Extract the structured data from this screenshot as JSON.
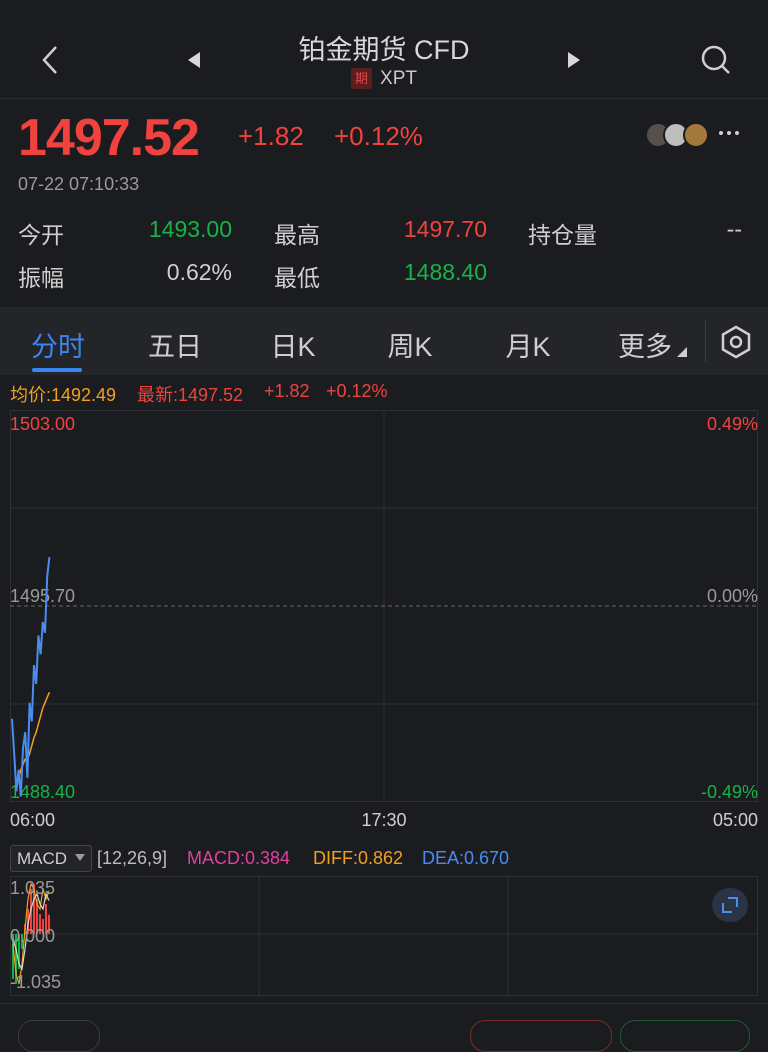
{
  "header": {
    "title": "铂金期货 CFD",
    "badge": "期",
    "symbol": "XPT"
  },
  "quote": {
    "price": "1497.52",
    "change": "+1.82",
    "change_pct": "+0.12%",
    "timestamp": "07-22 07:10:33"
  },
  "stats": {
    "open_label": "今开",
    "open": "1493.00",
    "high_label": "最高",
    "high": "1497.70",
    "oi_label": "持仓量",
    "oi": "--",
    "amp_label": "振幅",
    "amp": "0.62%",
    "low_label": "最低",
    "low": "1488.40"
  },
  "tabs": [
    "分时",
    "五日",
    "日K",
    "周K",
    "月K",
    "更多"
  ],
  "info": {
    "avg": "均价:1492.49",
    "latest": "最新:1497.52",
    "change": "+1.82",
    "change_pct": "+0.12%"
  },
  "chart_data": {
    "type": "line",
    "y_top": "1503.00",
    "y_mid": "1495.70",
    "y_bottom": "1488.40",
    "pct_top": "0.49%",
    "pct_mid": "0.00%",
    "pct_bottom": "-0.49%",
    "x_start": "06:00",
    "x_mid": "17:30",
    "x_end": "05:00",
    "ylim": [
      1488.4,
      1503.0
    ],
    "series": [
      {
        "values": [
          1491.5,
          1490.2,
          1488.8,
          1489.6,
          1488.6,
          1490.4,
          1491.0,
          1489.3,
          1492.1,
          1491.4,
          1493.5,
          1492.8,
          1494.6,
          1493.9,
          1495.1,
          1494.7,
          1496.8,
          1497.52
        ]
      },
      {
        "values": [
          null,
          null,
          1488.9,
          1489.3,
          1489.6,
          1489.8,
          1490.0,
          1490.0,
          1490.2,
          1490.5,
          1490.8,
          1491.0,
          1491.3,
          1491.6,
          1491.9,
          1492.1,
          1492.3,
          1492.49
        ]
      }
    ]
  },
  "macd": {
    "name": "MACD",
    "params": "[12,26,9]",
    "macd": "MACD:0.384",
    "diff": "DIFF:0.862",
    "dea": "DEA:0.670",
    "y_top": "1.035",
    "y_mid": "0.000",
    "y_bottom": "-1.035",
    "bars": [
      -0.9,
      -1.0,
      -0.7,
      -0.3,
      0.2,
      0.5,
      0.9,
      1.0,
      0.7,
      0.4,
      0.3,
      0.6,
      0.384
    ],
    "diff_line": [
      -0.2,
      -0.8,
      -1.0,
      -0.6,
      0.1,
      0.7,
      1.0,
      0.9,
      0.6,
      0.5,
      0.9,
      0.7,
      0.862
    ],
    "dea_line": [
      -0.1,
      -0.3,
      -0.6,
      -0.7,
      -0.3,
      0.2,
      0.5,
      0.7,
      0.8,
      0.6,
      0.5,
      0.8,
      0.67
    ]
  },
  "colors": {
    "up": "#f0433d",
    "down": "#17b347",
    "accent": "#3a86f0",
    "avg": "#f0a020",
    "macd": "#e040a0"
  }
}
